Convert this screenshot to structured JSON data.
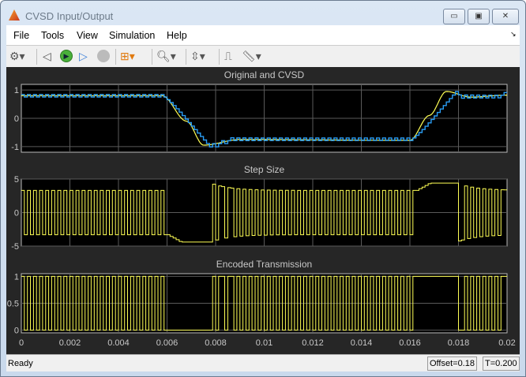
{
  "window": {
    "title": "CVSD Input/Output",
    "minimize": "▭",
    "maximize": "▣",
    "close": "✕"
  },
  "menu": [
    "File",
    "Tools",
    "View",
    "Simulation",
    "Help"
  ],
  "menu_undock": "↘",
  "toolbar": {
    "icons": [
      "gear-icon",
      "step-back-icon",
      "run-icon",
      "step-forward-icon",
      "stop-icon",
      "signal-select-icon",
      "zoom-icon",
      "autoscale-icon",
      "triggers-icon",
      "measure-icon"
    ]
  },
  "status": {
    "text": "Ready",
    "offset": "Offset=0.18",
    "time": "T=0.200"
  },
  "colors": {
    "original": "#ffff55",
    "cvsd": "#2a9df4",
    "axes_bg": "#000000",
    "panel_bg": "#262626",
    "grid": "#5a5a5a"
  },
  "chart_data": [
    {
      "type": "line",
      "title": "Original and CVSD",
      "xlim": [
        0,
        0.02
      ],
      "ylim": [
        -1.2,
        1.2
      ],
      "yticks": [
        "1",
        "0",
        "-1"
      ],
      "ytick_values": [
        1,
        0,
        -1
      ],
      "series": [
        {
          "name": "Original",
          "keypoints": [
            [
              0,
              0.8
            ],
            [
              0.0058,
              0.8
            ],
            [
              0.0068,
              -0.1
            ],
            [
              0.0075,
              -0.95
            ],
            [
              0.009,
              -0.75
            ],
            [
              0.016,
              -0.78
            ],
            [
              0.0168,
              0.1
            ],
            [
              0.0175,
              0.95
            ],
            [
              0.0185,
              0.75
            ],
            [
              0.02,
              0.82
            ]
          ]
        },
        {
          "name": "CVSD",
          "sample_period": 0.000125
        }
      ]
    },
    {
      "type": "line",
      "title": "Step Size",
      "xlim": [
        0,
        0.02
      ],
      "ylim": [
        -5,
        5
      ],
      "yticks": [
        "5",
        "0",
        "-5"
      ],
      "ytick_values": [
        5,
        0,
        -5
      ]
    },
    {
      "type": "line",
      "title": "Encoded Transmission",
      "xlim": [
        0,
        0.02
      ],
      "ylim": [
        -0.05,
        1.05
      ],
      "yticks": [
        "1",
        "0.5",
        "0"
      ],
      "ytick_values": [
        1,
        0.5,
        0
      ],
      "xticks": [
        "0",
        "0.002",
        "0.004",
        "0.006",
        "0.008",
        "0.01",
        "0.012",
        "0.014",
        "0.016",
        "0.018",
        "0.02"
      ]
    }
  ]
}
